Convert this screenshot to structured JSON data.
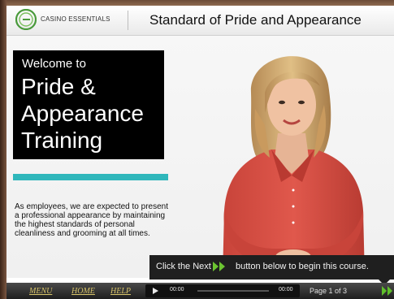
{
  "header": {
    "brand": "CASINO ESSENTIALS",
    "course_title": "Standard of Pride and Appearance"
  },
  "welcome": {
    "small": "Welcome to",
    "big": "Pride & Appearance Training"
  },
  "body_text": "As employees, we are expected to present a professional appearance by maintaining the highest standards of personal cleanliness and grooming at all times.",
  "callout": {
    "before": "Click the Next",
    "after": "button below to begin this course."
  },
  "nav": {
    "menu": "MENU",
    "home": "HOME",
    "help": "HELP"
  },
  "player": {
    "current_time": "00:00",
    "total_time": "00:00",
    "progress": 0
  },
  "page_indicator": "Page 1 of 3",
  "colors": {
    "accent_teal": "#2fb7bb",
    "logo_green": "#4a9a3c",
    "nav_link": "#d8c46a",
    "next_green": "#5fbf2a"
  }
}
